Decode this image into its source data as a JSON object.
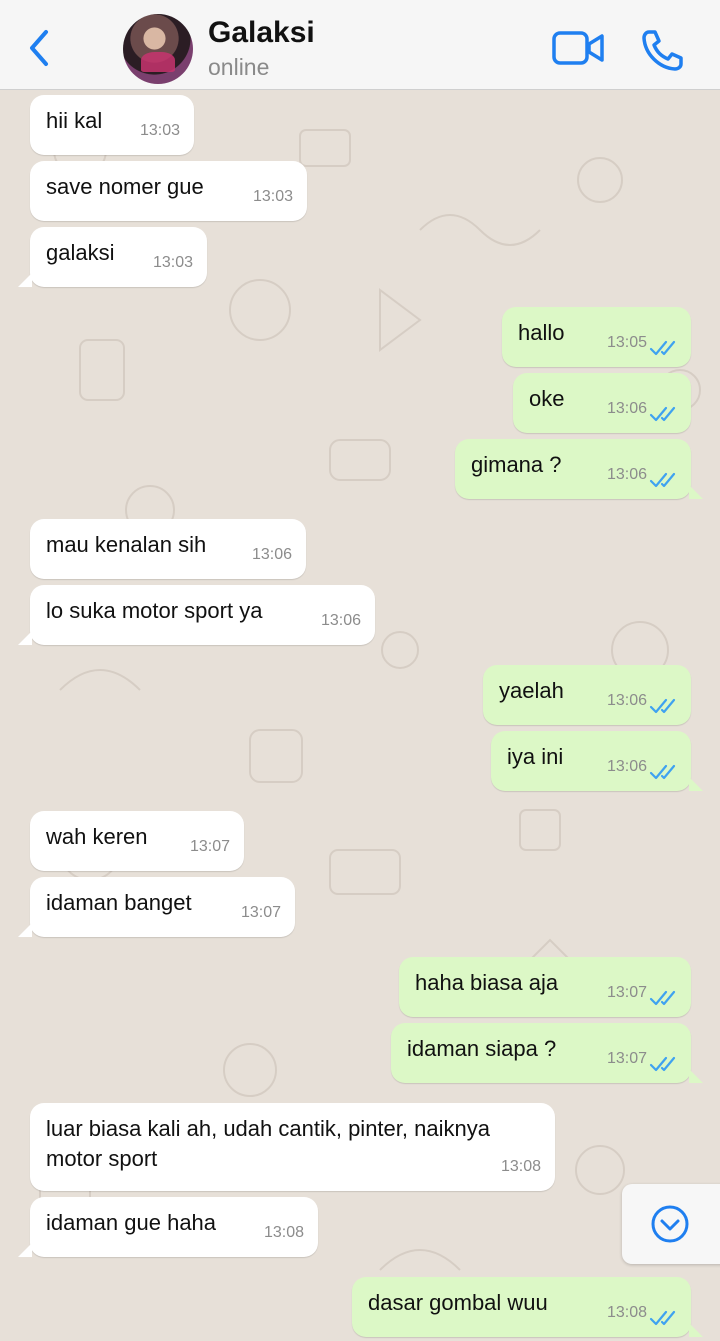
{
  "header": {
    "contact_name": "Galaksi",
    "status": "online",
    "icons": [
      "back-chevron-icon",
      "video-call-icon",
      "phone-call-icon"
    ],
    "accent_color": "#1f7ff0"
  },
  "colors": {
    "incoming_bubble": "#ffffff",
    "outgoing_bubble": "#dcf8c6",
    "read_ticks": "#3fa2f0",
    "wallpaper": "#e7e0d8"
  },
  "messages": [
    {
      "direction": "in",
      "text": "hii kal",
      "time": "13:03"
    },
    {
      "direction": "in",
      "text": "save nomer gue",
      "time": "13:03"
    },
    {
      "direction": "in",
      "text": "galaksi",
      "time": "13:03"
    },
    {
      "direction": "out",
      "text": "hallo",
      "time": "13:05",
      "status": "read"
    },
    {
      "direction": "out",
      "text": "oke",
      "time": "13:06",
      "status": "read"
    },
    {
      "direction": "out",
      "text": "gimana ?",
      "time": "13:06",
      "status": "read"
    },
    {
      "direction": "in",
      "text": "mau kenalan sih",
      "time": "13:06"
    },
    {
      "direction": "in",
      "text": "lo suka motor sport ya",
      "time": "13:06"
    },
    {
      "direction": "out",
      "text": "yaelah",
      "time": "13:06",
      "status": "read"
    },
    {
      "direction": "out",
      "text": "iya ini",
      "time": "13:06",
      "status": "read"
    },
    {
      "direction": "in",
      "text": "wah keren",
      "time": "13:07"
    },
    {
      "direction": "in",
      "text": "idaman banget",
      "time": "13:07"
    },
    {
      "direction": "out",
      "text": "haha biasa aja",
      "time": "13:07",
      "status": "read"
    },
    {
      "direction": "out",
      "text": "idaman siapa ?",
      "time": "13:07",
      "status": "read"
    },
    {
      "direction": "in",
      "text": "luar biasa kali ah, udah cantik, pinter, naiknya motor sport",
      "time": "13:08"
    },
    {
      "direction": "in",
      "text": "idaman gue haha",
      "time": "13:08"
    },
    {
      "direction": "out",
      "text": "dasar gombal wuu",
      "time": "13:08",
      "status": "read"
    }
  ],
  "scroll_button_icon": "chevron-down-circle-icon"
}
